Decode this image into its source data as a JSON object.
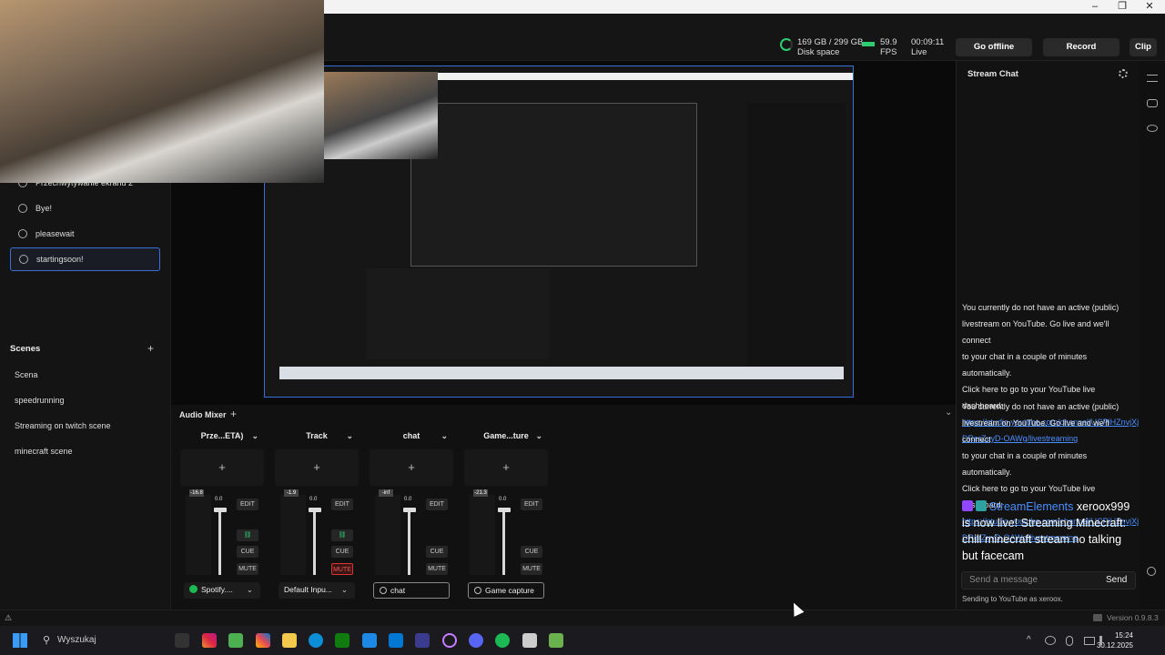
{
  "window": {
    "minimize": "–",
    "maximize": "❐",
    "close": "✕"
  },
  "topbar": {
    "disk_value": "169 GB / 299 GB",
    "disk_label": "Disk space",
    "fps_value": "59.9",
    "fps_label": "FPS",
    "time_value": "00:09:11",
    "time_label": "Live",
    "go_offline": "Go offline",
    "record": "Record",
    "clip": "Clip"
  },
  "sources": [
    {
      "label": "Przechwytywanie ekranu 2"
    },
    {
      "label": "Bye!"
    },
    {
      "label": "pleasewait"
    },
    {
      "label": "startingsoon!"
    }
  ],
  "scenes": {
    "title": "Scenes",
    "add": "+",
    "items": [
      "Scena",
      "speedrunning",
      "Streaming on twitch scene",
      "minecraft scene"
    ]
  },
  "mixer": {
    "title": "Audio Mixer",
    "add": "+",
    "collapse": "⌄",
    "edit": "EDIT",
    "cue": "CUE",
    "mute": "MUTE",
    "strips": [
      {
        "name": "Prze...ETA)",
        "meter": "-16.8",
        "fader": "0.0",
        "device": "Spotify....",
        "mute_active": false,
        "linked": true
      },
      {
        "name": "Track",
        "meter": "-1.9",
        "fader": "0.0",
        "device": "Default Inpu...",
        "mute_active": true,
        "linked": true
      },
      {
        "name": "chat",
        "meter": "-inf",
        "fader": "0.0",
        "device": "chat",
        "mute_active": false,
        "linked": false
      },
      {
        "name": "Game...ture",
        "meter": "-21.3",
        "fader": "0.0",
        "device": "Game capture",
        "mute_active": false,
        "linked": false
      }
    ]
  },
  "chat": {
    "title": "Stream Chat",
    "notice1": "You currently do not have an active (public)",
    "notice2": "livestream on YouTube. Go live and we'll connect",
    "notice3": "to your chat in a couple of minutes automatically.",
    "notice4": "Click here to go to your YouTube live dashboard:",
    "link1": "https://studio.youtube.com/channel/UCPiHZnvjXj",
    "link2": "DRerZuyD-OAWg/livestreaming",
    "bot_name": "StreamElements",
    "bot_msg1": "xeroox999",
    "bot_msg2": "is now live! Streaming Minecraft:",
    "bot_msg3": "chill minecraft stream no talking",
    "bot_msg4": "but facecam",
    "input_placeholder": "Send a message",
    "send": "Send",
    "sending_as": "Sending to YouTube as xeroox.",
    "avatar": "A"
  },
  "status": {
    "version": "Version 0.9.8.3"
  },
  "taskbar": {
    "search": "Wyszukaj",
    "time": "15:24",
    "date": "30.12.2025"
  },
  "colors": {
    "accent": "#3b6fd8",
    "live_green": "#2ecc71",
    "mute_red": "#e53935",
    "link": "#4a8fff"
  }
}
